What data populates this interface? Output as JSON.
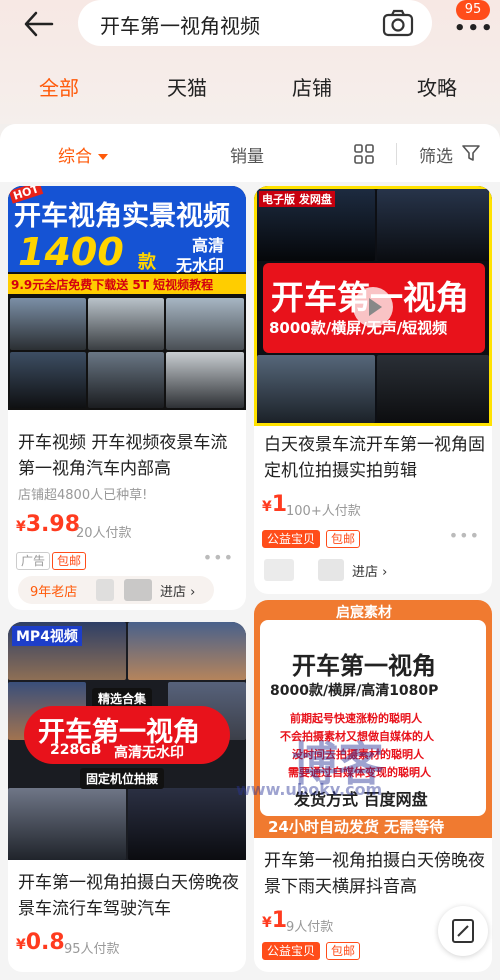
{
  "search": {
    "query": "开车第一视角视频",
    "more_badge": "95"
  },
  "tabs": [
    "全部",
    "天猫",
    "店铺",
    "攻略"
  ],
  "sortbar": {
    "comprehensive": "综合",
    "sales": "销量",
    "filter": "筛选"
  },
  "products": [
    {
      "banner": {
        "hot": "HOT",
        "headline": "开车视角实景视频",
        "count": "1400",
        "unit": "款",
        "hd": "高清",
        "no_wm": "无水印",
        "strip": "9.9元全店免费下载送 5T 短视频教程"
      },
      "title": "开车视频 开车视频夜景车流第一视角汽车内部高",
      "promo": "店铺超4800人已种草!",
      "price_symbol": "¥",
      "price": "3.98",
      "sold": "20人付款",
      "tags": [
        "广告",
        "包邮"
      ],
      "shop_age": "9年老店",
      "enter": "进店 ›"
    },
    {
      "banner": {
        "corner": "电子版 发网盘",
        "headline": "开车第一视角",
        "sub": "8000款/横屏/无声/短视频"
      },
      "title": "白天夜景车流开车第一视角固定机位拍摄实拍剪辑",
      "price_symbol": "¥",
      "price": "1",
      "sold": "100+人付款",
      "tags": [
        "公益宝贝",
        "包邮"
      ],
      "enter": "进店 ›"
    },
    {
      "banner": {
        "corner": "MP4视频",
        "pick": "精选合集",
        "headline": "开车第一视角",
        "size": "228GB",
        "hd": "高清无水印",
        "fixed": "固定机位拍摄"
      },
      "title": "开车第一视角拍摄白天傍晚夜景车流行车驾驶汽车",
      "price_symbol": "¥",
      "price": "0.8",
      "sold": "95人付款"
    },
    {
      "banner": {
        "brand": "启宸素材",
        "headline": "开车第一视角",
        "spec": "8000款/横屏/高清1080P",
        "line1": "前期起号快速涨粉的聪明人",
        "line2": "不会拍摄素材又想做自媒体的人",
        "line3": "没时间去拍摄素材的聪明人",
        "line4": "需要通过自媒体变现的聪明人",
        "delivery": "发货方式  百度网盘",
        "footer": "24小时自动发货  无需等待"
      },
      "title": "开车第一视角拍摄白天傍晚夜景下雨天横屏抖音高",
      "price_symbol": "¥",
      "price": "1",
      "sold": "9人付款",
      "tags": [
        "公益宝贝",
        "包邮"
      ]
    }
  ],
  "overlay": {
    "wm1": "博客",
    "wm2": "www.ubokv.com"
  },
  "colors": {
    "accent": "#ff5a0a",
    "price": "#ff3b1f",
    "tag": "#ff4d1a"
  }
}
